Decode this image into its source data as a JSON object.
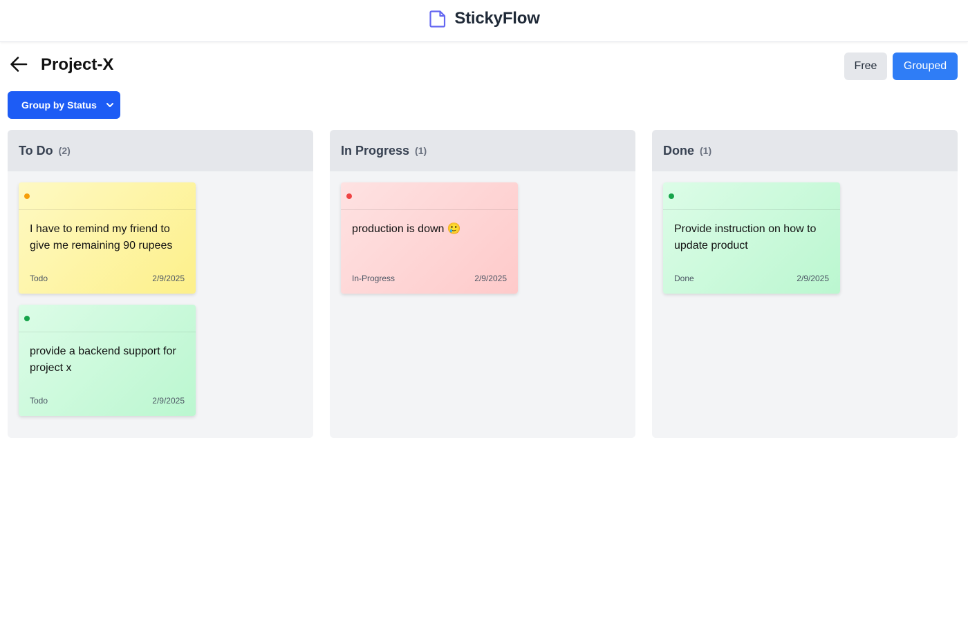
{
  "app": {
    "name": "StickyFlow",
    "icon": "sticky-note-icon",
    "accent": "#1d5cf5"
  },
  "project": {
    "title": "Project-X",
    "back_icon": "arrow-left-icon"
  },
  "view_toggle": {
    "free_label": "Free",
    "grouped_label": "Grouped",
    "active": "Grouped"
  },
  "group_select": {
    "label": "Group by Status",
    "icon": "chevron-down-icon"
  },
  "columns": [
    {
      "title": "To Do",
      "count": "(2)",
      "notes": [
        {
          "color": "#fde68a",
          "dot_color": "#f59e0b",
          "text": "I have to remind my friend to give me remaining 90 rupees",
          "status": "Todo",
          "date": "2/9/2025"
        },
        {
          "color": "#bbf7d0",
          "dot_color": "#16a34a",
          "text": "provide a backend support for project x",
          "status": "Todo",
          "date": "2/9/2025"
        }
      ]
    },
    {
      "title": "In Progress",
      "count": "(1)",
      "notes": [
        {
          "color": "#fecaca",
          "dot_color": "#ef4444",
          "text": "production is down 🥲",
          "status": "In-Progress",
          "date": "2/9/2025"
        }
      ]
    },
    {
      "title": "Done",
      "count": "(1)",
      "notes": [
        {
          "color": "#bbf7d0",
          "dot_color": "#16a34a",
          "text": "Provide instruction on how to update product",
          "status": "Done",
          "date": "2/9/2025"
        }
      ]
    }
  ]
}
